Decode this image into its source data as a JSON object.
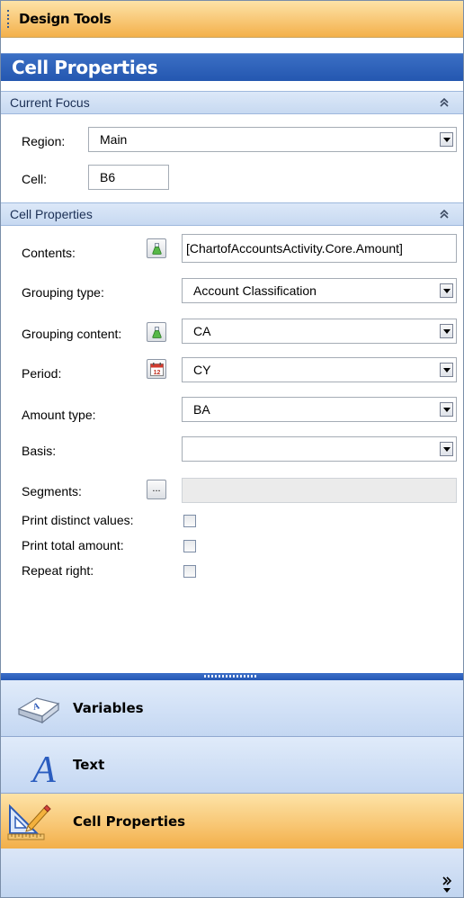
{
  "panel": {
    "title": "Design Tools"
  },
  "header": {
    "title": "Cell Properties"
  },
  "current_focus": {
    "section_title": "Current Focus",
    "region": {
      "label": "Region:",
      "value": "Main"
    },
    "cell": {
      "label": "Cell:",
      "value": "B6"
    }
  },
  "cell_properties": {
    "section_title": "Cell Properties",
    "contents": {
      "label": "Contents:",
      "value": "[ChartofAccountsActivity.Core.Amount]"
    },
    "grouping_type": {
      "label": "Grouping type:",
      "value": "Account Classification"
    },
    "grouping_content": {
      "label": "Grouping content:",
      "value": "CA"
    },
    "period": {
      "label": "Period:",
      "value": "CY"
    },
    "amount_type": {
      "label": "Amount type:",
      "value": "BA"
    },
    "basis": {
      "label": "Basis:",
      "value": ""
    },
    "segments": {
      "label": "Segments:",
      "button": "...",
      "value": ""
    },
    "print_distinct_values": {
      "label": "Print distinct values:",
      "checked": false
    },
    "print_total_amount": {
      "label": "Print total amount:",
      "checked": false
    },
    "repeat_right": {
      "label": "Repeat right:",
      "checked": false
    }
  },
  "nav": {
    "variables": "Variables",
    "text": "Text",
    "cell_properties": "Cell Properties"
  },
  "colors": {
    "accent_orange": "#f8c775",
    "header_blue": "#2457b0",
    "section_blue": "#c7d9f1"
  }
}
